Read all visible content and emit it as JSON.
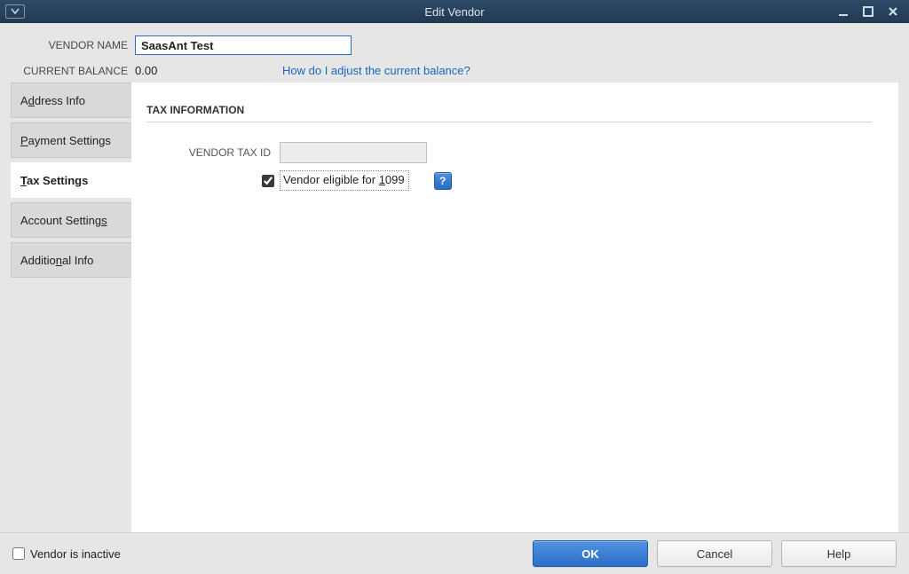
{
  "window": {
    "title": "Edit Vendor"
  },
  "header": {
    "vendor_name_label": "VENDOR NAME",
    "vendor_name_value": "SaasAnt Test",
    "current_balance_label": "CURRENT BALANCE",
    "current_balance_value": "0.00",
    "adjust_link": "How do I adjust the current balance?"
  },
  "tabs": {
    "address_pre": "A",
    "address_u": "d",
    "address_post": "dress Info",
    "payment_u": "P",
    "payment_post": "ayment Settings",
    "tax_u": "T",
    "tax_post": "ax Settings",
    "account_pre": "Account Setting",
    "account_u": "s",
    "additional_pre": "Additio",
    "additional_u": "n",
    "additional_post": "al Info"
  },
  "panel": {
    "section_title": "TAX INFORMATION",
    "vendor_tax_id_label": "VENDOR TAX ID",
    "vendor_tax_id_value": "",
    "eligible_pre": "Vendor eligible for ",
    "eligible_u": "1",
    "eligible_post": "099",
    "eligible_checked": true,
    "help_icon": "?"
  },
  "footer": {
    "inactive_label": "Vendor is inactive",
    "ok": "OK",
    "cancel": "Cancel",
    "help": "Help"
  }
}
